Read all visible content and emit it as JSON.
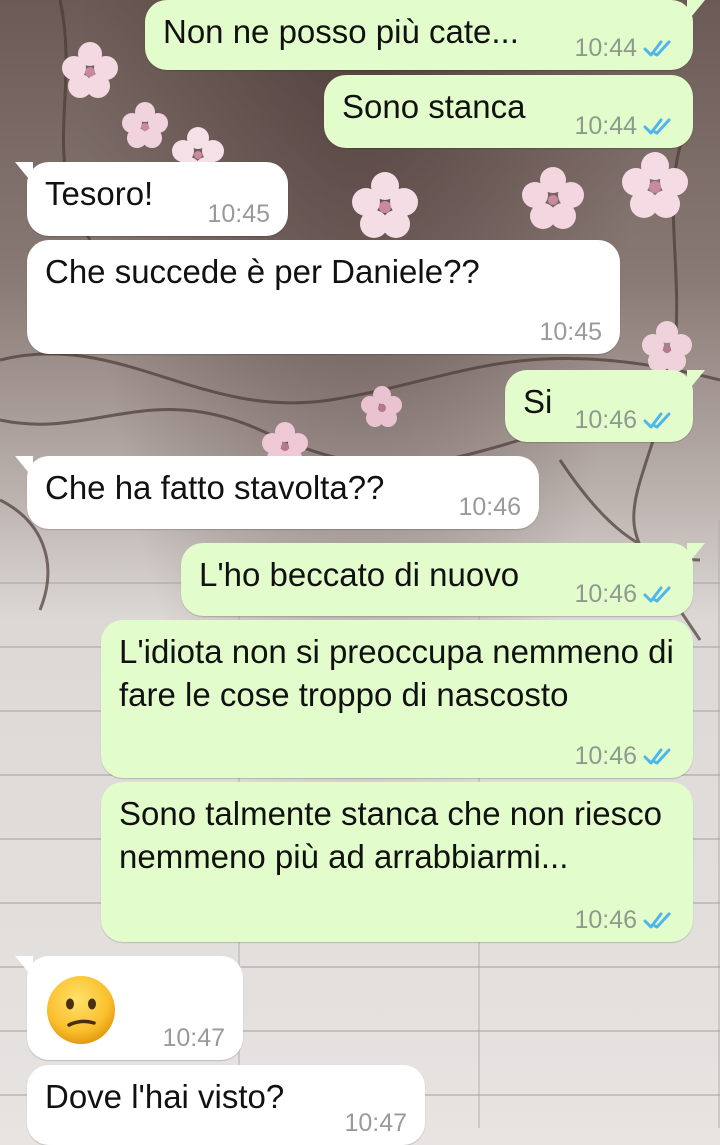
{
  "chat": {
    "messages": [
      {
        "id": "m1",
        "dir": "out",
        "text": "Non ne posso più cate...",
        "time": "10:44",
        "status": "read"
      },
      {
        "id": "m2",
        "dir": "out",
        "text": "Sono stanca",
        "time": "10:44",
        "status": "read"
      },
      {
        "id": "m3",
        "dir": "in",
        "text": "Tesoro!",
        "time": "10:45"
      },
      {
        "id": "m4",
        "dir": "in",
        "text": "Che succede è per Daniele??",
        "time": "10:45"
      },
      {
        "id": "m5",
        "dir": "out",
        "text": "Si",
        "time": "10:46",
        "status": "read"
      },
      {
        "id": "m6",
        "dir": "in",
        "text": "Che ha fatto stavolta??",
        "time": "10:46"
      },
      {
        "id": "m7",
        "dir": "out",
        "text": "L'ho beccato di nuovo",
        "time": "10:46",
        "status": "read"
      },
      {
        "id": "m8",
        "dir": "out",
        "text": "L'idiota non si preoccupa nemmeno di fare le cose troppo di nascosto",
        "time": "10:46",
        "status": "read"
      },
      {
        "id": "m9",
        "dir": "out",
        "text": "Sono talmente stanca che non riesco nemmeno più ad arrabbiarmi...",
        "time": "10:46",
        "status": "read"
      },
      {
        "id": "m10",
        "dir": "in",
        "emoji": "confused-face",
        "time": "10:47"
      },
      {
        "id": "m11",
        "dir": "in",
        "text": "Dove l'hai visto?",
        "time": "10:47"
      }
    ]
  },
  "colors": {
    "outgoing_bubble": "#e2fdcb",
    "incoming_bubble": "#ffffff",
    "read_ticks": "#4fb6ec",
    "timestamp": "#8f9a8f"
  }
}
